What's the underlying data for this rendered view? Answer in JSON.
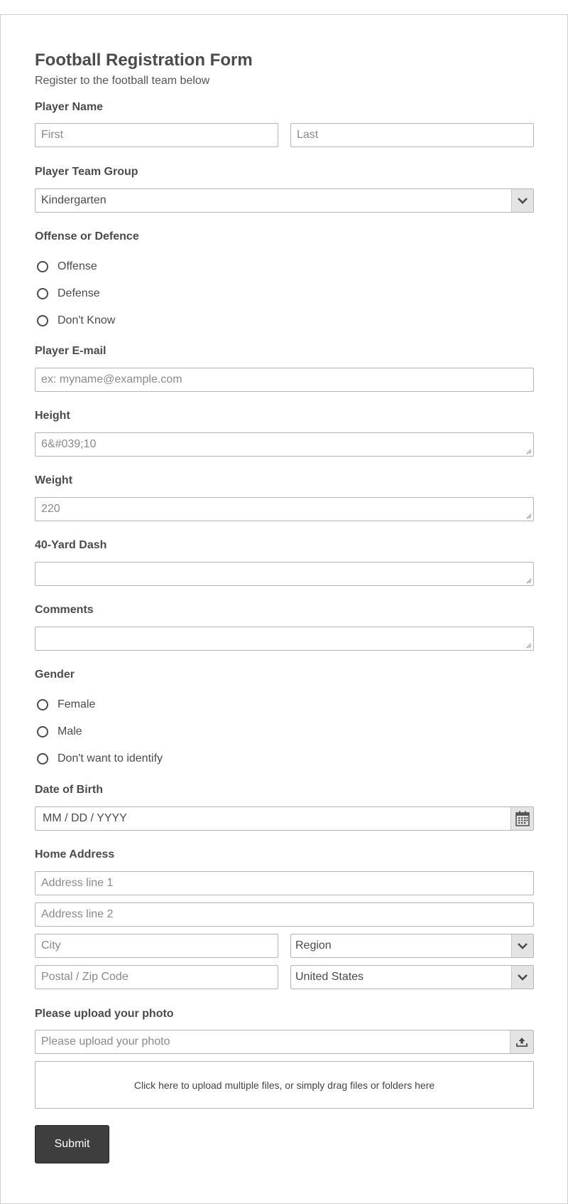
{
  "form": {
    "title": "Football Registration Form",
    "subtitle": "Register to the football team below"
  },
  "player_name": {
    "label": "Player Name",
    "first_placeholder": "First",
    "last_placeholder": "Last"
  },
  "team_group": {
    "label": "Player Team Group",
    "value": "Kindergarten"
  },
  "position": {
    "label": "Offense or Defence",
    "options": [
      "Offense",
      "Defense",
      "Don't Know"
    ]
  },
  "email": {
    "label": "Player E-mail",
    "placeholder": "ex: myname@example.com"
  },
  "height": {
    "label": "Height",
    "placeholder": "6&#039;10"
  },
  "weight": {
    "label": "Weight",
    "placeholder": "220"
  },
  "dash": {
    "label": "40-Yard Dash",
    "value": ""
  },
  "comments": {
    "label": "Comments",
    "value": ""
  },
  "gender": {
    "label": "Gender",
    "options": [
      "Female",
      "Male",
      "Don't want to identify"
    ]
  },
  "dob": {
    "label": "Date of Birth",
    "placeholder": "MM / DD / YYYY"
  },
  "address": {
    "label": "Home Address",
    "line1_placeholder": "Address line 1",
    "line2_placeholder": "Address line 2",
    "city_placeholder": "City",
    "region_value": "Region",
    "postal_placeholder": "Postal / Zip Code",
    "country_value": "United States"
  },
  "upload": {
    "label": "Please upload your photo",
    "placeholder": "Please upload your photo",
    "dropzone_text": "Click here to upload multiple files, or simply drag files or folders here"
  },
  "submit_label": "Submit",
  "icons": {
    "select_arrow": "chevron-down-icon",
    "calendar": "calendar-icon",
    "upload": "upload-icon"
  }
}
